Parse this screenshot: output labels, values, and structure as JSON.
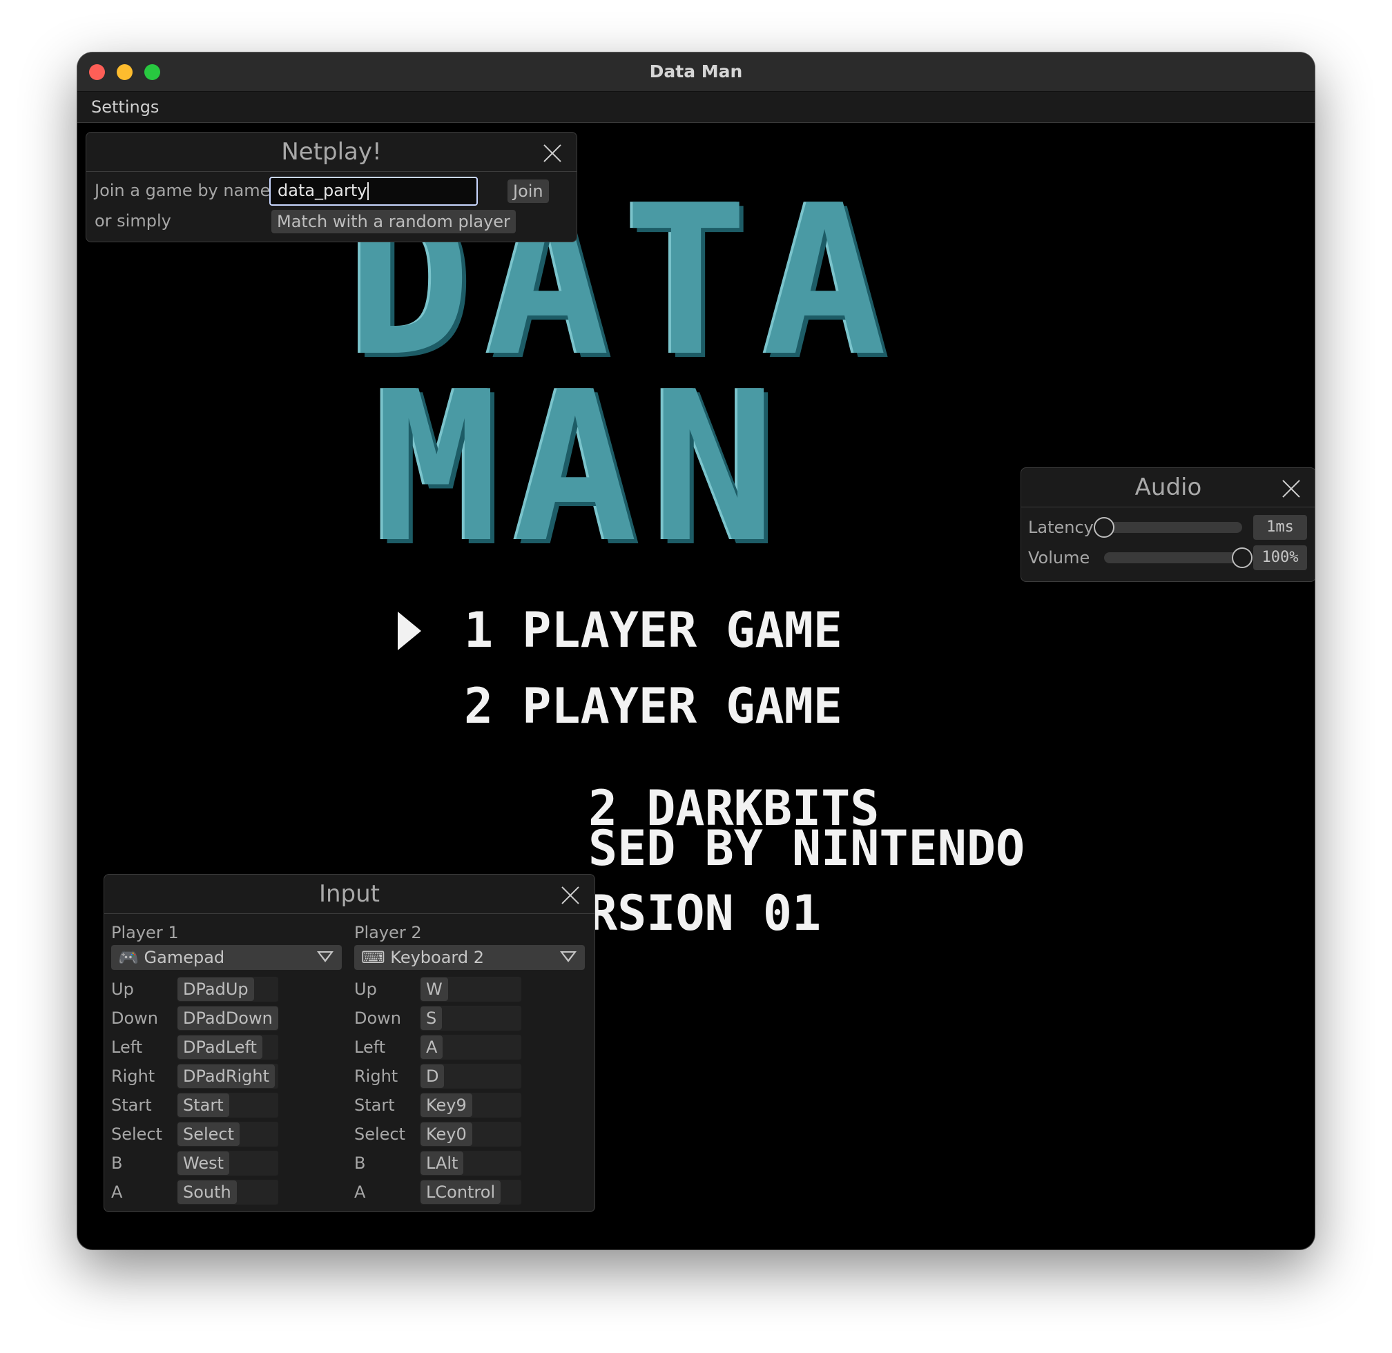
{
  "window": {
    "title": "Data Man"
  },
  "menubar": {
    "settings": "Settings"
  },
  "game": {
    "logo_line1": "DATA",
    "logo_line2": "MAN",
    "option1": "1 PLAYER GAME",
    "option2": "2 PLAYER GAME",
    "footer1": "2 DARKBITS",
    "footer2": "SED BY NINTENDO",
    "footer3": "RSION 01"
  },
  "netplay": {
    "title": "Netplay!",
    "join_label": "Join a game by name",
    "name_value": "data_party",
    "join_button": "Join",
    "or_label": "or simply",
    "random_button": "Match with a random player"
  },
  "audio": {
    "title": "Audio",
    "latency_label": "Latency",
    "latency_value": "1ms",
    "latency_fraction": 0.0,
    "volume_label": "Volume",
    "volume_value": "100%",
    "volume_fraction": 1.0
  },
  "input": {
    "title": "Input",
    "player1": {
      "label": "Player 1",
      "device_icon": "gamepad-icon",
      "device": "Gamepad",
      "bindings": [
        {
          "action": "Up",
          "key": "DPadUp"
        },
        {
          "action": "Down",
          "key": "DPadDown"
        },
        {
          "action": "Left",
          "key": "DPadLeft"
        },
        {
          "action": "Right",
          "key": "DPadRight"
        },
        {
          "action": "Start",
          "key": "Start"
        },
        {
          "action": "Select",
          "key": "Select"
        },
        {
          "action": "B",
          "key": "West"
        },
        {
          "action": "A",
          "key": "South"
        }
      ]
    },
    "player2": {
      "label": "Player 2",
      "device_icon": "keyboard-icon",
      "device": "Keyboard 2",
      "bindings": [
        {
          "action": "Up",
          "key": "W"
        },
        {
          "action": "Down",
          "key": "S"
        },
        {
          "action": "Left",
          "key": "A"
        },
        {
          "action": "Right",
          "key": "D"
        },
        {
          "action": "Start",
          "key": "Key9"
        },
        {
          "action": "Select",
          "key": "Key0"
        },
        {
          "action": "B",
          "key": "LAlt"
        },
        {
          "action": "A",
          "key": "LControl"
        }
      ]
    }
  }
}
